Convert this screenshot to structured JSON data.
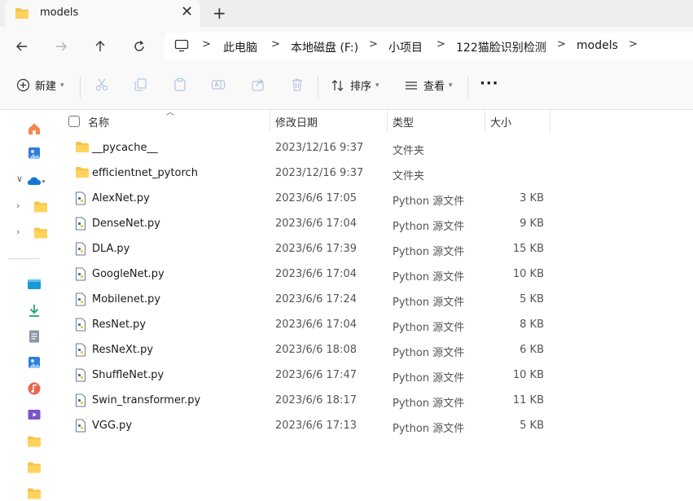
{
  "tab": {
    "title": "models",
    "close": "✕",
    "new_tab": "+"
  },
  "breadcrumb": [
    "此电脑",
    "本地磁盘 (F:)",
    "小项目",
    "122猫脸识别检测",
    "models"
  ],
  "toolbar": {
    "new_label": "新建",
    "sort_label": "排序",
    "view_label": "查看",
    "more": "···"
  },
  "columns": {
    "name": "名称",
    "date": "修改日期",
    "type": "类型",
    "size": "大小"
  },
  "files": [
    {
      "name": "__pycache__",
      "date": "2023/12/16 9:37",
      "type": "文件夹",
      "size": "",
      "kind": "folder"
    },
    {
      "name": "efficientnet_pytorch",
      "date": "2023/12/16 9:37",
      "type": "文件夹",
      "size": "",
      "kind": "folder"
    },
    {
      "name": "AlexNet.py",
      "date": "2023/6/6 17:05",
      "type": "Python 源文件",
      "size": "3 KB",
      "kind": "py"
    },
    {
      "name": "DenseNet.py",
      "date": "2023/6/6 17:04",
      "type": "Python 源文件",
      "size": "9 KB",
      "kind": "py"
    },
    {
      "name": "DLA.py",
      "date": "2023/6/6 17:39",
      "type": "Python 源文件",
      "size": "15 KB",
      "kind": "py"
    },
    {
      "name": "GoogleNet.py",
      "date": "2023/6/6 17:04",
      "type": "Python 源文件",
      "size": "10 KB",
      "kind": "py"
    },
    {
      "name": "Mobilenet.py",
      "date": "2023/6/6 17:24",
      "type": "Python 源文件",
      "size": "5 KB",
      "kind": "py"
    },
    {
      "name": "ResNet.py",
      "date": "2023/6/6 17:04",
      "type": "Python 源文件",
      "size": "8 KB",
      "kind": "py"
    },
    {
      "name": "ResNeXt.py",
      "date": "2023/6/6 18:08",
      "type": "Python 源文件",
      "size": "6 KB",
      "kind": "py"
    },
    {
      "name": "ShuffleNet.py",
      "date": "2023/6/6 17:47",
      "type": "Python 源文件",
      "size": "10 KB",
      "kind": "py"
    },
    {
      "name": "Swin_transformer.py",
      "date": "2023/6/6 18:17",
      "type": "Python 源文件",
      "size": "11 KB",
      "kind": "py"
    },
    {
      "name": "VGG.py",
      "date": "2023/6/6 17:13",
      "type": "Python 源文件",
      "size": "5 KB",
      "kind": "py"
    }
  ],
  "colors": {
    "folder": "#f4c54a",
    "accent": "#0067c0"
  },
  "icons": {
    "sidebar": [
      "home-icon",
      "gallery-icon",
      "onedrive-icon",
      "folder-icon",
      "folder-icon",
      "desktop-icon",
      "downloads-icon",
      "documents-icon",
      "pictures-icon",
      "music-icon",
      "videos-icon",
      "folder-icon",
      "folder-icon",
      "folder-icon"
    ]
  }
}
